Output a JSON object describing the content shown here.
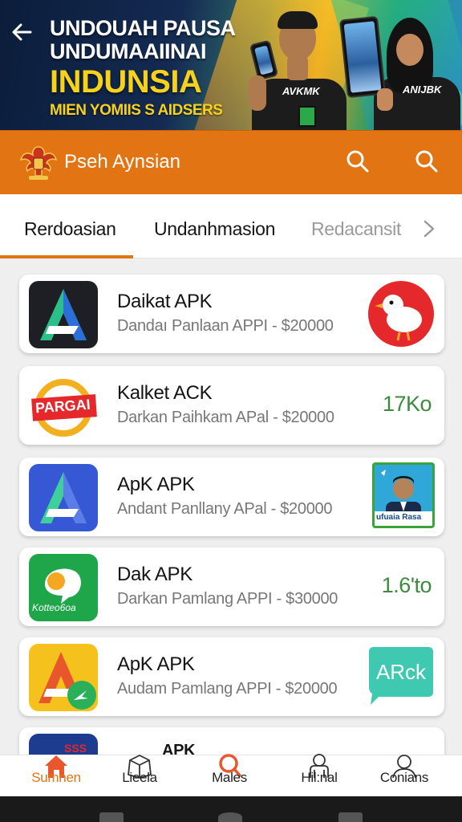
{
  "banner": {
    "line1": "UNDOUAH PAUSA",
    "line2": "UNDUMAAIINAI",
    "line3": "INDUNSIA",
    "line4": "MIEN YOMIIS S AIDSERS",
    "shirt_text_1": "AVKMK",
    "shirt_text_2": "ANIJBK"
  },
  "header": {
    "title": "Pseh Aynsian"
  },
  "tabs": [
    {
      "label": "Rerdoasian",
      "active": true
    },
    {
      "label": "Undanhmasion",
      "active": false
    },
    {
      "label": "Redacansit",
      "active": false
    }
  ],
  "apps": [
    {
      "name": "Daikat APK",
      "desc": "Dandaı Panlaan APPI - $20000",
      "side": ""
    },
    {
      "name": "Kalket ACK",
      "desc": "Darkan Paihkam APal - $20000",
      "side": "17Ko",
      "logo_text": "PARGAI"
    },
    {
      "name": "ApK APK",
      "desc": "Andant Panllany APal - $20000",
      "side": "",
      "thumb_caption": "ufuaia Rasa"
    },
    {
      "name": "Dak APK",
      "desc": "Darkan Pamlang APPI - $30000",
      "side": "1.6'to",
      "logo_text": "Kotteo6oa"
    },
    {
      "name": "ApK APK",
      "desc": "Audam Pamlang APPI - $20000",
      "side": "ARck"
    },
    {
      "name": "APK",
      "logo_text": "SSS"
    }
  ],
  "bottom_nav": [
    {
      "label": "Sumnen",
      "icon": "home-icon",
      "active": true
    },
    {
      "label": "Lieela",
      "icon": "box-icon",
      "active": false
    },
    {
      "label": "Males",
      "icon": "search-icon",
      "active": false
    },
    {
      "label": "Hil:nal",
      "icon": "person-icon",
      "active": false
    },
    {
      "label": "Conians",
      "icon": "user-icon",
      "active": false
    }
  ],
  "colors": {
    "accent": "#e37413",
    "side_text": "#3d8a3e",
    "banner_yellow": "#f7d21d"
  }
}
